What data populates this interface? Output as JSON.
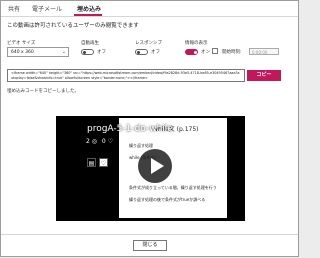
{
  "tabs": [
    {
      "label": "共有"
    },
    {
      "label": "電子メール"
    },
    {
      "label": "埋め込み"
    }
  ],
  "accent_color": "#c2185b",
  "info_text": "この動画は許可されているユーザーのみ閲覧できます",
  "options": {
    "video_size_label": "ビデオ サイズ",
    "video_size_value": "640 x 360",
    "autoplay_label": "自動再生",
    "autoplay_state": "オフ",
    "responsive_label": "レスポンシブ",
    "responsive_state": "オフ",
    "info_label": "情報の表示",
    "info_state": "オン",
    "start_time_label": "開始時刻:",
    "start_time_value": "0:00:00"
  },
  "embed": {
    "code": "<iframe width=\"640\" height=\"360\" src=\"https://web.microsoftstream.com/embed/video/f9a2828d-93e5-4718-be85-e30495467aaa?autoplay=false&showinfo=true\" allowfullscreen style=\"border:none;\"></iframe>",
    "copy_button": "コピー",
    "copied_message": "埋め込みコードをコピーしました。"
  },
  "video": {
    "title": "progA-5-1-do-while",
    "views": "2",
    "likes": "0",
    "slide_title": "while文 (p.175)",
    "slide_lines": [
      "繰り返す処理",
      "while (条件式)",
      "条件式が成り立っている間，繰り返す処理を行う",
      "繰り返す処理の後で条件式がtrueか調べる"
    ]
  },
  "footer": {
    "close_button": "閉じる"
  }
}
